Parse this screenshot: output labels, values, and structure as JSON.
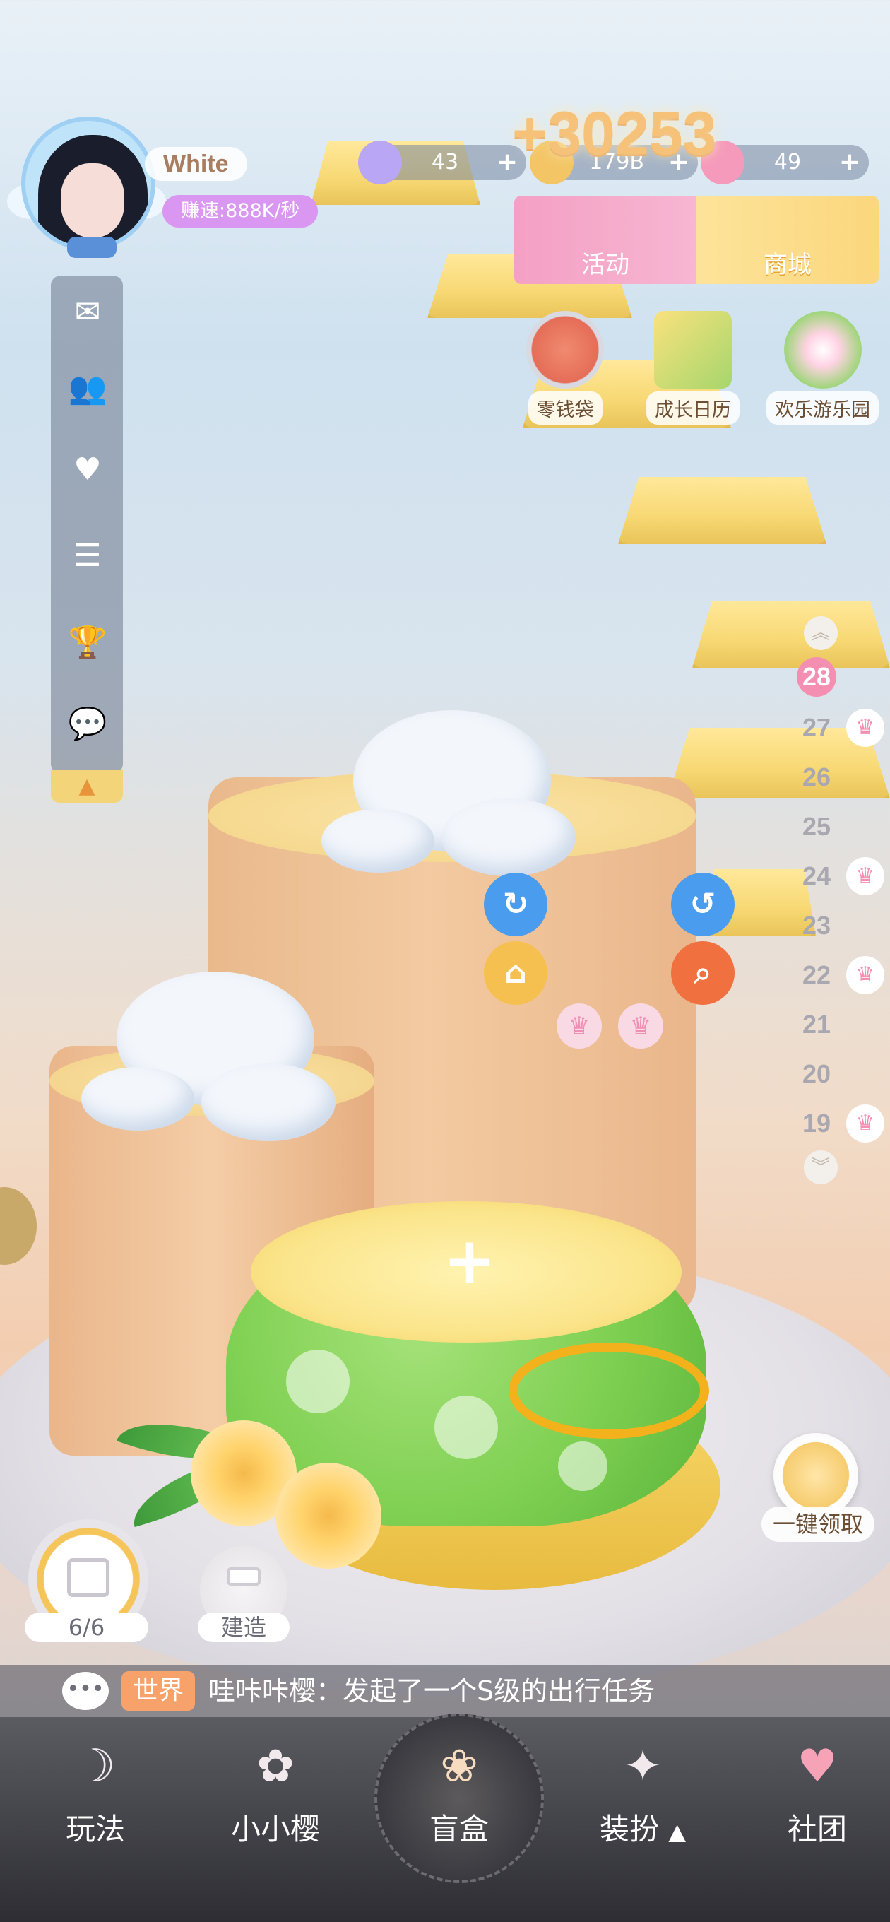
{
  "profile": {
    "name": "White",
    "speed": "赚速:888K/秒"
  },
  "currencies": [
    {
      "name": "snowflake",
      "value": "43",
      "icon": "snowflake-icon",
      "color": "#b9a6f5"
    },
    {
      "name": "coin",
      "value": "179B",
      "icon": "coin-icon",
      "color": "#f3c565"
    },
    {
      "name": "star",
      "value": "49",
      "icon": "star-icon",
      "color": "#f59abb"
    }
  ],
  "bonus_popup": "+30253",
  "top_buttons": {
    "activity": "活动",
    "shop": "商城"
  },
  "mini_entries": [
    {
      "label": "零钱袋",
      "icon": "purse-icon"
    },
    {
      "label": "成长日历",
      "icon": "calendar-icon"
    },
    {
      "label": "欢乐游乐园",
      "icon": "ferris-wheel-icon"
    }
  ],
  "sidebar": [
    {
      "icon": "mail-icon",
      "glyph": "✉"
    },
    {
      "icon": "friends-icon",
      "glyph": "👥"
    },
    {
      "icon": "pet-icon",
      "glyph": "♥"
    },
    {
      "icon": "notice-icon",
      "glyph": "☰"
    },
    {
      "icon": "trophy-icon",
      "glyph": "🏆"
    },
    {
      "icon": "chat-icon",
      "glyph": "💬"
    }
  ],
  "floors": {
    "current": "28",
    "list": [
      "27",
      "26",
      "25",
      "24",
      "23",
      "22",
      "21",
      "20",
      "19"
    ],
    "marked": [
      "27",
      "24",
      "22",
      "19"
    ]
  },
  "gift": {
    "label": "6/6"
  },
  "build": {
    "label": "建造"
  },
  "claim_all": "一键领取",
  "chat": {
    "channel": "世界",
    "message": "哇咔咔樱：发起了一个S级的出行任务"
  },
  "bottom_nav": [
    {
      "label": "玩法",
      "icon": "card-icon",
      "glyph": "☽"
    },
    {
      "label": "小小樱",
      "icon": "sakura-icon",
      "glyph": "✿"
    },
    {
      "label": "盲盒",
      "icon": "blind-box-icon",
      "glyph": "❀"
    },
    {
      "label": "装扮",
      "icon": "dress-up-icon",
      "glyph": "✦"
    },
    {
      "label": "社团",
      "icon": "club-cup-icon",
      "glyph": "♥"
    }
  ],
  "colors": {
    "accent_pink": "#f58fb2",
    "gold": "#f3b21c",
    "chat_tag": "#f7a26b"
  }
}
